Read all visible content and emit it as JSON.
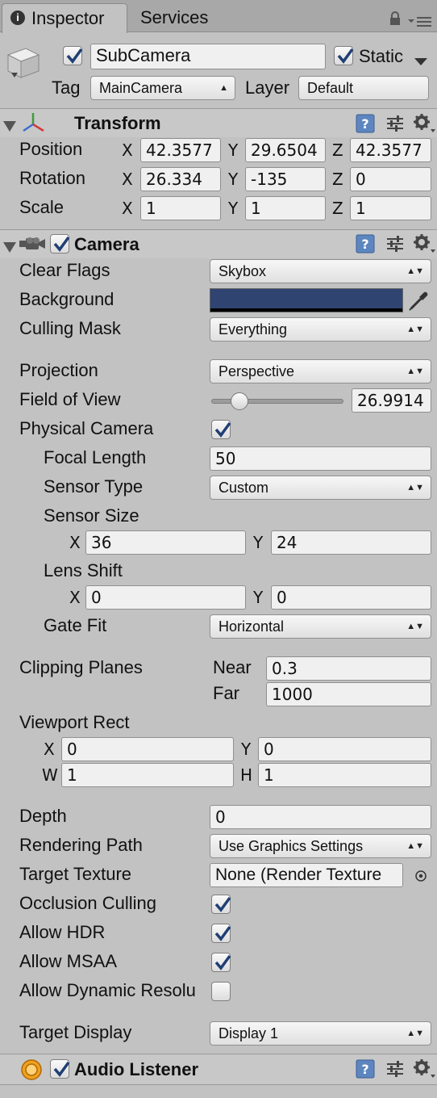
{
  "tabs": [
    {
      "label": "Inspector"
    },
    {
      "label": "Services"
    }
  ],
  "object": {
    "name": "SubCamera",
    "static_label": "Static",
    "tag_label": "Tag",
    "tag_value": "MainCamera",
    "layer_label": "Layer",
    "layer_value": "Default"
  },
  "transform": {
    "title": "Transform",
    "rows": [
      {
        "label": "Position",
        "x": "42.3577",
        "y": "29.6504",
        "z": "42.3577"
      },
      {
        "label": "Rotation",
        "x": "26.334",
        "y": "-135",
        "z": "0"
      },
      {
        "label": "Scale",
        "x": "1",
        "y": "1",
        "z": "1"
      }
    ],
    "axis_x": "X",
    "axis_y": "Y",
    "axis_z": "Z"
  },
  "camera": {
    "title": "Camera",
    "clear_flags_label": "Clear Flags",
    "clear_flags_value": "Skybox",
    "background_label": "Background",
    "background_color": "#2f4470",
    "culling_mask_label": "Culling Mask",
    "culling_mask_value": "Everything",
    "projection_label": "Projection",
    "projection_value": "Perspective",
    "fov_label": "Field of View",
    "fov_value": "26.9914",
    "fov_fraction": 0.17,
    "physical_camera_label": "Physical Camera",
    "focal_length_label": "Focal Length",
    "focal_length_value": "50",
    "sensor_type_label": "Sensor Type",
    "sensor_type_value": "Custom",
    "sensor_size_label": "Sensor Size",
    "sensor_x": "36",
    "sensor_y": "24",
    "lens_shift_label": "Lens Shift",
    "lens_x": "0",
    "lens_y": "0",
    "gate_fit_label": "Gate Fit",
    "gate_fit_value": "Horizontal",
    "clipping_label": "Clipping Planes",
    "near_label": "Near",
    "near_value": "0.3",
    "far_label": "Far",
    "far_value": "1000",
    "viewport_label": "Viewport Rect",
    "vp_x_label": "X",
    "vp_x": "0",
    "vp_y_label": "Y",
    "vp_y": "0",
    "vp_w_label": "W",
    "vp_w": "1",
    "vp_h_label": "H",
    "vp_h": "1",
    "depth_label": "Depth",
    "depth_value": "0",
    "rendering_path_label": "Rendering Path",
    "rendering_path_value": "Use Graphics Settings",
    "target_texture_label": "Target Texture",
    "target_texture_value": "None (Render Texture",
    "occlusion_label": "Occlusion Culling",
    "hdr_label": "Allow HDR",
    "msaa_label": "Allow MSAA",
    "dynamic_res_label": "Allow Dynamic Resolu",
    "target_display_label": "Target Display",
    "target_display_value": "Display 1"
  },
  "audio_listener": {
    "title": "Audio Listener"
  },
  "colors": {
    "accent_check": "#1f3f73",
    "panel": "#c2c2c2"
  }
}
